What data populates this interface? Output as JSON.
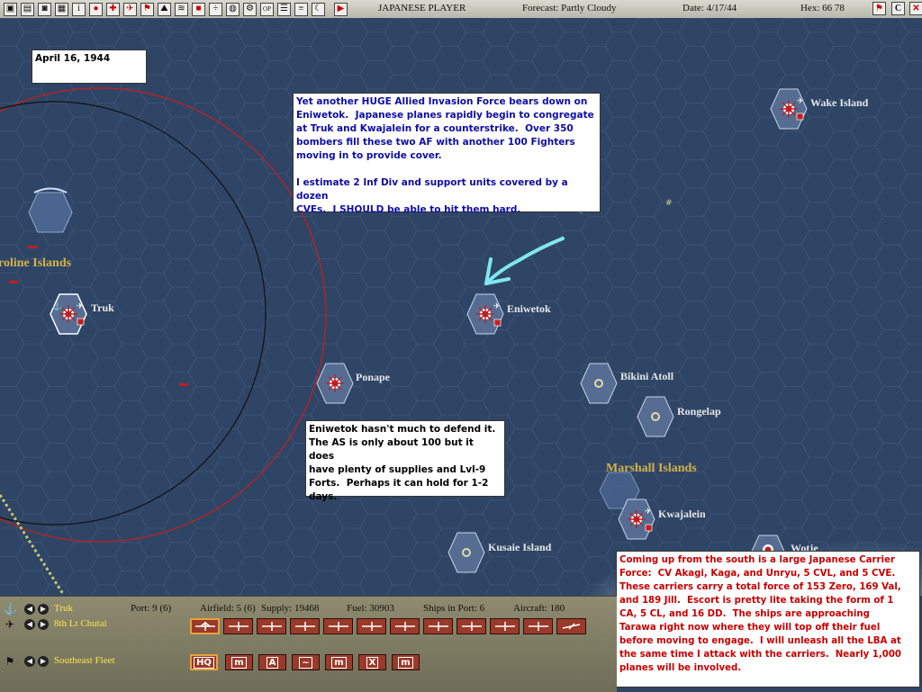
{
  "topbar": {
    "player": "JAPANESE PLAYER",
    "forecast": "Forecast: Partly Cloudy",
    "date": "Date: 4/17/44",
    "hex": "Hex: 66 78",
    "buttons_left": [
      "panel-icon",
      "doc-icon",
      "camera-icon",
      "grid-icon",
      "info-icon",
      "flag-icon",
      "unit-red-icon",
      "plane-icon",
      "plane-flag-icon",
      "terrain-icon",
      "ships-icon",
      "chart-icon",
      "divide-icon",
      "globe-icon",
      "cog-icon",
      "op-icon",
      "report-icon",
      "menu-icon",
      "moon-icon",
      "play-icon"
    ],
    "buttons_right": [
      "flag-right-icon",
      "c-icon",
      "close-icon"
    ]
  },
  "map": {
    "region_labels": [
      "roline Islands",
      "Marshall Islands"
    ],
    "bases": [
      {
        "name": "Wake Island"
      },
      {
        "name": "Truk"
      },
      {
        "name": "Eniwetok"
      },
      {
        "name": "Ponape"
      },
      {
        "name": "Bikini Atoll"
      },
      {
        "name": "Rongelap"
      },
      {
        "name": "Kwajalein"
      },
      {
        "name": "Kusaie Island"
      },
      {
        "name": "Wotje"
      }
    ]
  },
  "notes": {
    "date": "April 16, 1944",
    "invasion": "Yet another HUGE Allied Invasion Force bears down on\nEniwetok.  Japanese planes rapidly begin to congregate\nat Truk and Kwajalein for a counterstrike.  Over 350\nbombers fill these two AF with another 100 Fighters\nmoving in to provide cover.\n\nI estimate 2 Inf Div and support units covered by a dozen\nCVEs.  I SHOULD be able to hit them hard.",
    "eniwetok": "Eniwetok hasn't much to defend it.\nThe AS is only about 100 but it does\nhave plenty of supplies and Lvl-9\nForts.  Perhaps it can hold for 1-2\ndays.",
    "carrier": "Coming up from the south is a large Japanese Carrier\nForce:  CV Akagi, Kaga, and Unryu, 5 CVL, and 5 CVE.\nThese carriers carry a total force of 153 Zero, 169 Val,\nand 189 Jill.  Escort is pretty lite taking the form of 1\nCA, 5 CL, and 16 DD.  The ships are approaching\nTarawa right now where they will top off their fuel\nbefore moving to engage.  I will unleash all the LBA at\nthe same time I attack with the carriers.  Nearly 1,000\nplanes will be involved."
  },
  "bottombar": {
    "base_name": "Truk",
    "port": "Port: 9 (6)",
    "airfield": "Airfield: 5 (6)",
    "supply": "Supply: 19468",
    "fuel": "Fuel: 30903",
    "ships_in_port": "Ships in Port: 6",
    "aircraft": "Aircraft: 180",
    "air_unit": "8th Lt Chutai",
    "fleet": "Southeast Fleet",
    "command_buttons": [
      "HQ",
      "m",
      "A",
      "~",
      "m",
      "X",
      "m"
    ]
  },
  "colors": {
    "ocean": "#2f4566",
    "base_hex": "#556d92",
    "region_label": "#d4b24a",
    "range_ring": "#c21f1f",
    "arrow": "#7fe7ef"
  }
}
